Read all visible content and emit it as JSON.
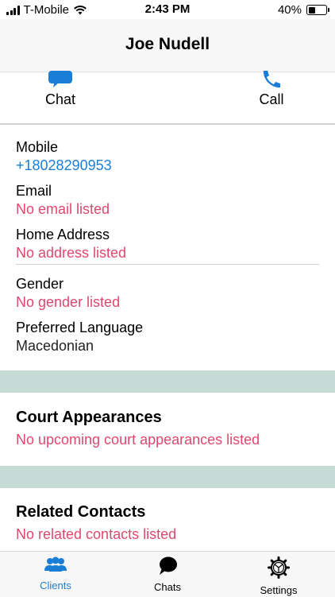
{
  "status_bar": {
    "carrier": "T-Mobile",
    "time": "2:43 PM",
    "battery_percent_label": "40%",
    "battery_level": 0.4
  },
  "nav": {
    "title": "Joe Nudell"
  },
  "actions": {
    "chat_label": "Chat",
    "call_label": "Call"
  },
  "colors": {
    "accent": "#1a7ed6",
    "empty_text": "#e0476f",
    "section_band": "#c7dbd6"
  },
  "details": {
    "mobile": {
      "label": "Mobile",
      "value": "+18028290953"
    },
    "email": {
      "label": "Email",
      "value": "No email listed"
    },
    "address": {
      "label": "Home Address",
      "value": "No address listed"
    },
    "gender": {
      "label": "Gender",
      "value": "No gender listed"
    },
    "language": {
      "label": "Preferred Language",
      "value": "Macedonian"
    }
  },
  "court": {
    "title": "Court Appearances",
    "empty": "No upcoming court appearances listed"
  },
  "related": {
    "title": "Related Contacts",
    "empty": "No related contacts listed"
  },
  "tabs": [
    {
      "label": "Clients",
      "icon": "people-icon",
      "active": true
    },
    {
      "label": "Chats",
      "icon": "chat-bubble-icon",
      "active": false
    },
    {
      "label": "Settings",
      "icon": "gear-icon",
      "active": false
    }
  ]
}
